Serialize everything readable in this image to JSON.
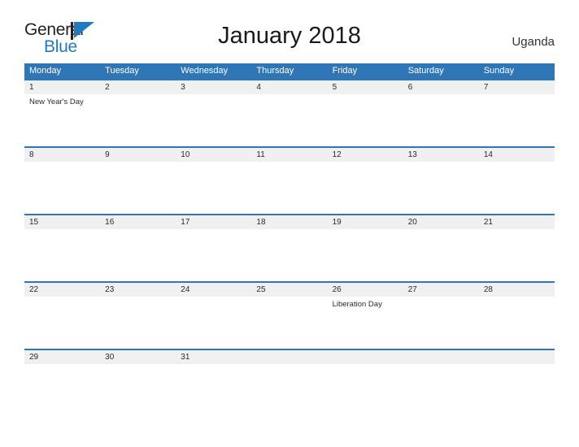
{
  "brand": {
    "name_part1": "General",
    "name_part2": "Blue",
    "mark": "flag-triangle-icon",
    "accent_color": "#1f7ac0"
  },
  "header": {
    "title": "January 2018",
    "region": "Uganda"
  },
  "colors": {
    "header_blue": "#2f76b6",
    "date_band_gray": "#f0f0f0",
    "text_dark": "#2b2b2b",
    "white": "#ffffff"
  },
  "calendar": {
    "month": "January",
    "year": "2018",
    "weekday_headers": [
      "Monday",
      "Tuesday",
      "Wednesday",
      "Thursday",
      "Friday",
      "Saturday",
      "Sunday"
    ],
    "weeks": [
      {
        "days": [
          {
            "date": "1",
            "event": "New Year's Day"
          },
          {
            "date": "2",
            "event": ""
          },
          {
            "date": "3",
            "event": ""
          },
          {
            "date": "4",
            "event": ""
          },
          {
            "date": "5",
            "event": ""
          },
          {
            "date": "6",
            "event": ""
          },
          {
            "date": "7",
            "event": ""
          }
        ]
      },
      {
        "days": [
          {
            "date": "8",
            "event": ""
          },
          {
            "date": "9",
            "event": ""
          },
          {
            "date": "10",
            "event": ""
          },
          {
            "date": "11",
            "event": ""
          },
          {
            "date": "12",
            "event": ""
          },
          {
            "date": "13",
            "event": ""
          },
          {
            "date": "14",
            "event": ""
          }
        ]
      },
      {
        "days": [
          {
            "date": "15",
            "event": ""
          },
          {
            "date": "16",
            "event": ""
          },
          {
            "date": "17",
            "event": ""
          },
          {
            "date": "18",
            "event": ""
          },
          {
            "date": "19",
            "event": ""
          },
          {
            "date": "20",
            "event": ""
          },
          {
            "date": "21",
            "event": ""
          }
        ]
      },
      {
        "days": [
          {
            "date": "22",
            "event": ""
          },
          {
            "date": "23",
            "event": ""
          },
          {
            "date": "24",
            "event": ""
          },
          {
            "date": "25",
            "event": ""
          },
          {
            "date": "26",
            "event": "Liberation Day"
          },
          {
            "date": "27",
            "event": ""
          },
          {
            "date": "28",
            "event": ""
          }
        ]
      },
      {
        "days": [
          {
            "date": "29",
            "event": ""
          },
          {
            "date": "30",
            "event": ""
          },
          {
            "date": "31",
            "event": ""
          },
          {
            "date": "",
            "event": ""
          },
          {
            "date": "",
            "event": ""
          },
          {
            "date": "",
            "event": ""
          },
          {
            "date": "",
            "event": ""
          }
        ]
      }
    ]
  }
}
